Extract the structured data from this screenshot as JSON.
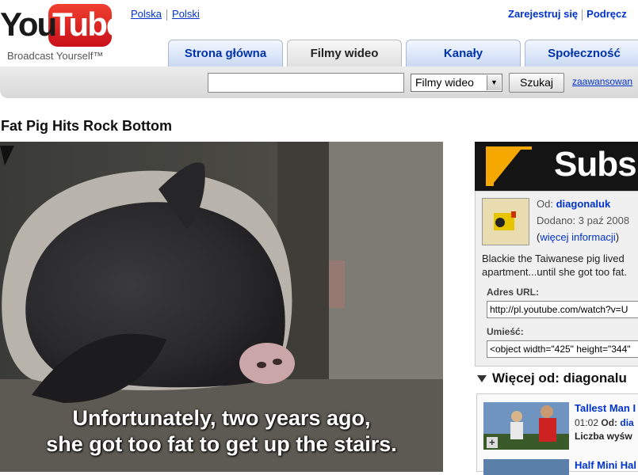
{
  "logo": {
    "word1": "You",
    "word2": "Tube",
    "tagline": "Broadcast Yourself™"
  },
  "header": {
    "lang": [
      "Polska",
      "Polski"
    ],
    "signup": "Zarejestruj się",
    "help": "Podręcz"
  },
  "tabs": [
    {
      "label": "Strona główna",
      "active": false
    },
    {
      "label": "Filmy wideo",
      "active": true
    },
    {
      "label": "Kanały",
      "active": false
    },
    {
      "label": "Społeczność",
      "active": false
    }
  ],
  "search": {
    "value": "",
    "category": "Filmy wideo",
    "button": "Szukaj",
    "advanced": "zaawansowan"
  },
  "video": {
    "title": "Fat Pig Hits Rock Bottom",
    "subtitle_line1": "Unfortunately, two years ago,",
    "subtitle_line2": "she got too fat to get up the stairs."
  },
  "channel": {
    "banner_text": "Subs",
    "from_label": "Od:",
    "author": "diagonaluk",
    "added": "Dodano: 3 paź 2008",
    "more_info": "więcej informacji",
    "desc_line1": "Blackie the Taiwanese pig lived",
    "desc_line2": "apartment...until she got too fat.",
    "url_label": "Adres URL:",
    "url_value": "http://pl.youtube.com/watch?v=U",
    "embed_label": "Umieść:",
    "embed_value": "<object width=\"425\" height=\"344\""
  },
  "more": {
    "heading": "Więcej od: diagonalu",
    "items": [
      {
        "title": "Tallest Man I",
        "duration": "01:02",
        "from_label": "Od:",
        "author": "dia",
        "views": "Liczba wyśw"
      },
      {
        "title": "Half Mini Hal"
      }
    ]
  },
  "colors": {
    "logo_red": "#e62117",
    "link": "#0033cc",
    "tab_blue": "#0033aa"
  }
}
